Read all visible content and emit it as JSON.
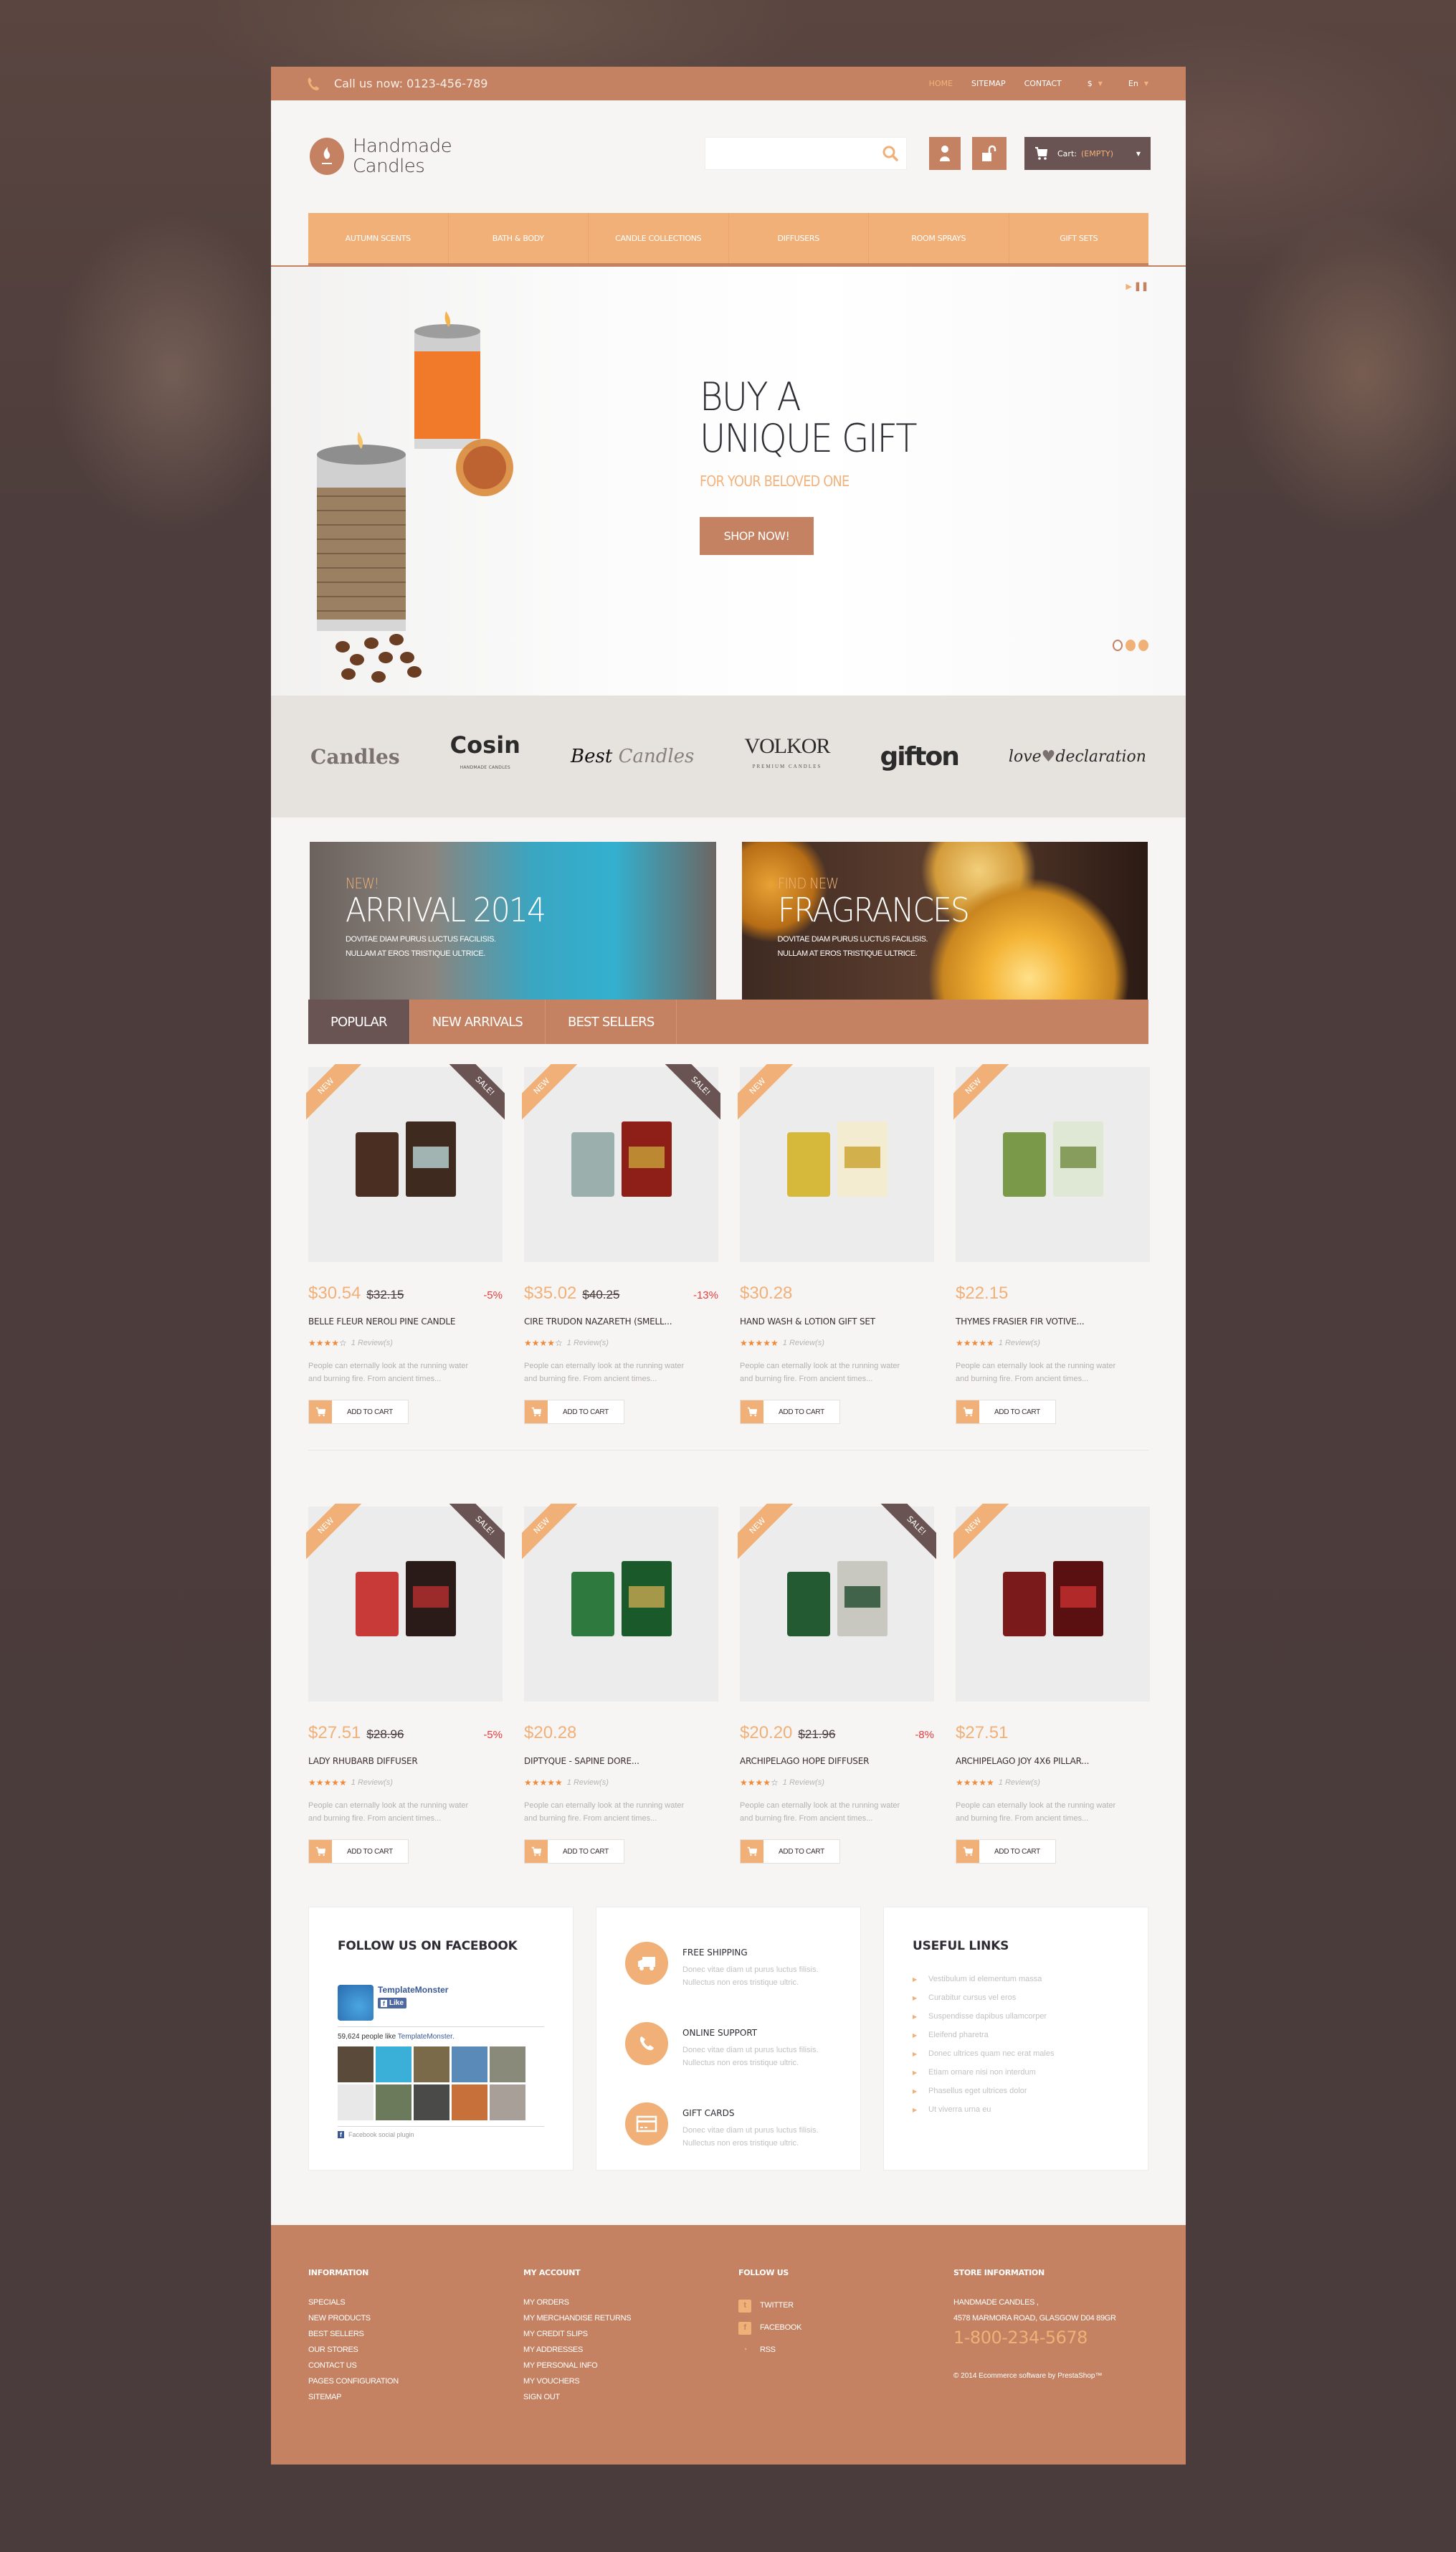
{
  "topbar": {
    "phone_text": "Call us now: 0123-456-789",
    "links": [
      "HOME",
      "SITEMAP",
      "CONTACT"
    ],
    "active_link": "HOME",
    "currency": "$",
    "language": "En"
  },
  "header": {
    "logo_line1": "Handmade",
    "logo_line2": "Candles",
    "search_placeholder": "",
    "search_value": "",
    "cart_label": "Cart:",
    "cart_status": "(EMPTY)"
  },
  "nav": {
    "items": [
      "AUTUMN SCENTS",
      "BATH & BODY",
      "CANDLE COLLECTIONS",
      "DIFFUSERS",
      "ROOM SPRAYS",
      "GIFT SETS"
    ]
  },
  "slider": {
    "title_line1": "BUY A",
    "title_line2": "UNIQUE GIFT",
    "subtitle": "FOR YOUR BELOVED ONE",
    "button": "SHOP NOW!",
    "slide_count": 3,
    "active_slide": 1
  },
  "brands": {
    "candles": "Candles",
    "cosin": "Cosin",
    "cosin_sub": "HANDMADE CANDLES",
    "best": "Best",
    "best_2": "Candles",
    "volkor": "VOLKOR",
    "volkor_sub": "PREMIUM CANDLES",
    "gifton": "gifton",
    "love_1": "love",
    "love_2": "declaration"
  },
  "banners": [
    {
      "kicker": "NEW!",
      "title": "ARRIVAL 2014",
      "line1": "DOVITAE DIAM PURUS LUCTUS FACILISIS.",
      "line2": "NULLAM AT EROS TRISTIQUE ULTRICE."
    },
    {
      "kicker": "FIND NEW",
      "title": "FRAGRANCES",
      "line1": "DOVITAE DIAM PURUS LUCTUS FACILISIS.",
      "line2": "NULLAM AT EROS TRISTIQUE ULTRICE."
    }
  ],
  "tabs": [
    "POPULAR",
    "NEW ARRIVALS",
    "BEST SELLERS"
  ],
  "active_tab": "POPULAR",
  "product_common": {
    "new_label": "NEW",
    "sale_label": "SALE!",
    "add_to_cart": "ADD TO CART",
    "description": "People can eternally look at the running water and burning fire. From ancient times..."
  },
  "products": [
    {
      "name": "BELLE FLEUR NEROLI PINE CANDLE",
      "price": "$30.54",
      "old_price": "$32.15",
      "discount": "-5%",
      "rating": 4,
      "reviews": "1 Review(s)",
      "new": true,
      "sale": true
    },
    {
      "name": "CIRE TRUDON NAZARETH (SMELL...",
      "price": "$35.02",
      "old_price": "$40.25",
      "discount": "-13%",
      "rating": 4,
      "reviews": "1 Review(s)",
      "new": true,
      "sale": true
    },
    {
      "name": "HAND WASH & LOTION GIFT SET",
      "price": "$30.28",
      "old_price": "",
      "discount": "",
      "rating": 5,
      "reviews": "1 Review(s)",
      "new": true,
      "sale": false
    },
    {
      "name": "THYMES FRASIER FIR VOTIVE...",
      "price": "$22.15",
      "old_price": "",
      "discount": "",
      "rating": 5,
      "reviews": "1 Review(s)",
      "new": true,
      "sale": false
    },
    {
      "name": "LADY RHUBARB DIFFUSER",
      "price": "$27.51",
      "old_price": "$28.96",
      "discount": "-5%",
      "rating": 5,
      "reviews": "1 Review(s)",
      "new": true,
      "sale": true
    },
    {
      "name": "DIPTYQUE - SAPINE DORE...",
      "price": "$20.28",
      "old_price": "",
      "discount": "",
      "rating": 5,
      "reviews": "1 Review(s)",
      "new": true,
      "sale": false
    },
    {
      "name": "ARCHIPELAGO HOPE DIFFUSER",
      "price": "$20.20",
      "old_price": "$21.96",
      "discount": "-8%",
      "rating": 4,
      "reviews": "1 Review(s)",
      "new": true,
      "sale": true
    },
    {
      "name": "ARCHIPELAGO JOY 4X6 PILLAR...",
      "price": "$27.51",
      "old_price": "",
      "discount": "",
      "rating": 5,
      "reviews": "1 Review(s)",
      "new": true,
      "sale": false
    }
  ],
  "facebook": {
    "title": "FOLLOW US ON FACEBOOK",
    "page_name": "TemplateMonster",
    "like_label": "Like",
    "count_text": "59,624 people like",
    "count_link": "TemplateMonster.",
    "plugin_label": "Facebook social plugin"
  },
  "services": [
    {
      "icon": "truck-icon",
      "title": "FREE SHIPPING",
      "line1": "Donec vitae diam ut purus luctus filisis.",
      "line2": "Nullectus non eros tristique ultric."
    },
    {
      "icon": "phone-icon",
      "title": "ONLINE SUPPORT",
      "line1": "Donec vitae diam ut purus luctus filisis.",
      "line2": "Nullectus non eros tristique ultric."
    },
    {
      "icon": "credit-card-icon",
      "title": "GIFT CARDS",
      "line1": "Donec vitae diam ut purus luctus filisis.",
      "line2": "Nullectus non eros tristique ultric."
    }
  ],
  "useful_links": {
    "title": "USEFUL LINKS",
    "items": [
      "Vestibulum id elementum massa",
      "Curabitur cursus vel eros",
      "Suspendisse dapibus ullamcorper",
      "Eleifend pharetra",
      "Donec ultrices quam nec erat males",
      "Etiam ornare nisi non interdum",
      "Phasellus eget ultrices dolor",
      "Ut viverra urna eu"
    ]
  },
  "footer": {
    "information": {
      "title": "INFORMATION",
      "items": [
        "SPECIALS",
        "NEW PRODUCTS",
        "BEST SELLERS",
        "OUR STORES",
        "CONTACT US",
        "PAGES CONFIGURATION",
        "SITEMAP"
      ]
    },
    "account": {
      "title": "MY ACCOUNT",
      "items": [
        "MY ORDERS",
        "MY MERCHANDISE RETURNS",
        "MY CREDIT SLIPS",
        "MY ADDRESSES",
        "MY PERSONAL INFO",
        "MY VOUCHERS",
        "SIGN OUT"
      ]
    },
    "follow": {
      "title": "FOLLOW US",
      "items": [
        "TWITTER",
        "FACEBOOK",
        "RSS"
      ]
    },
    "store": {
      "title": "STORE INFORMATION",
      "name": "HANDMADE CANDLES ,",
      "address": "4578 MARMORA ROAD, GLASGOW D04 89GR",
      "phone": "1-800-234-5678",
      "copyright": "© 2014 Ecommerce software by PrestaShop™"
    }
  },
  "colors": {
    "accent": "#c48262",
    "accent_light": "#f0b078",
    "dark": "#6a5453",
    "sale_red": "#e63c3c",
    "background": "#4a3c3c"
  }
}
